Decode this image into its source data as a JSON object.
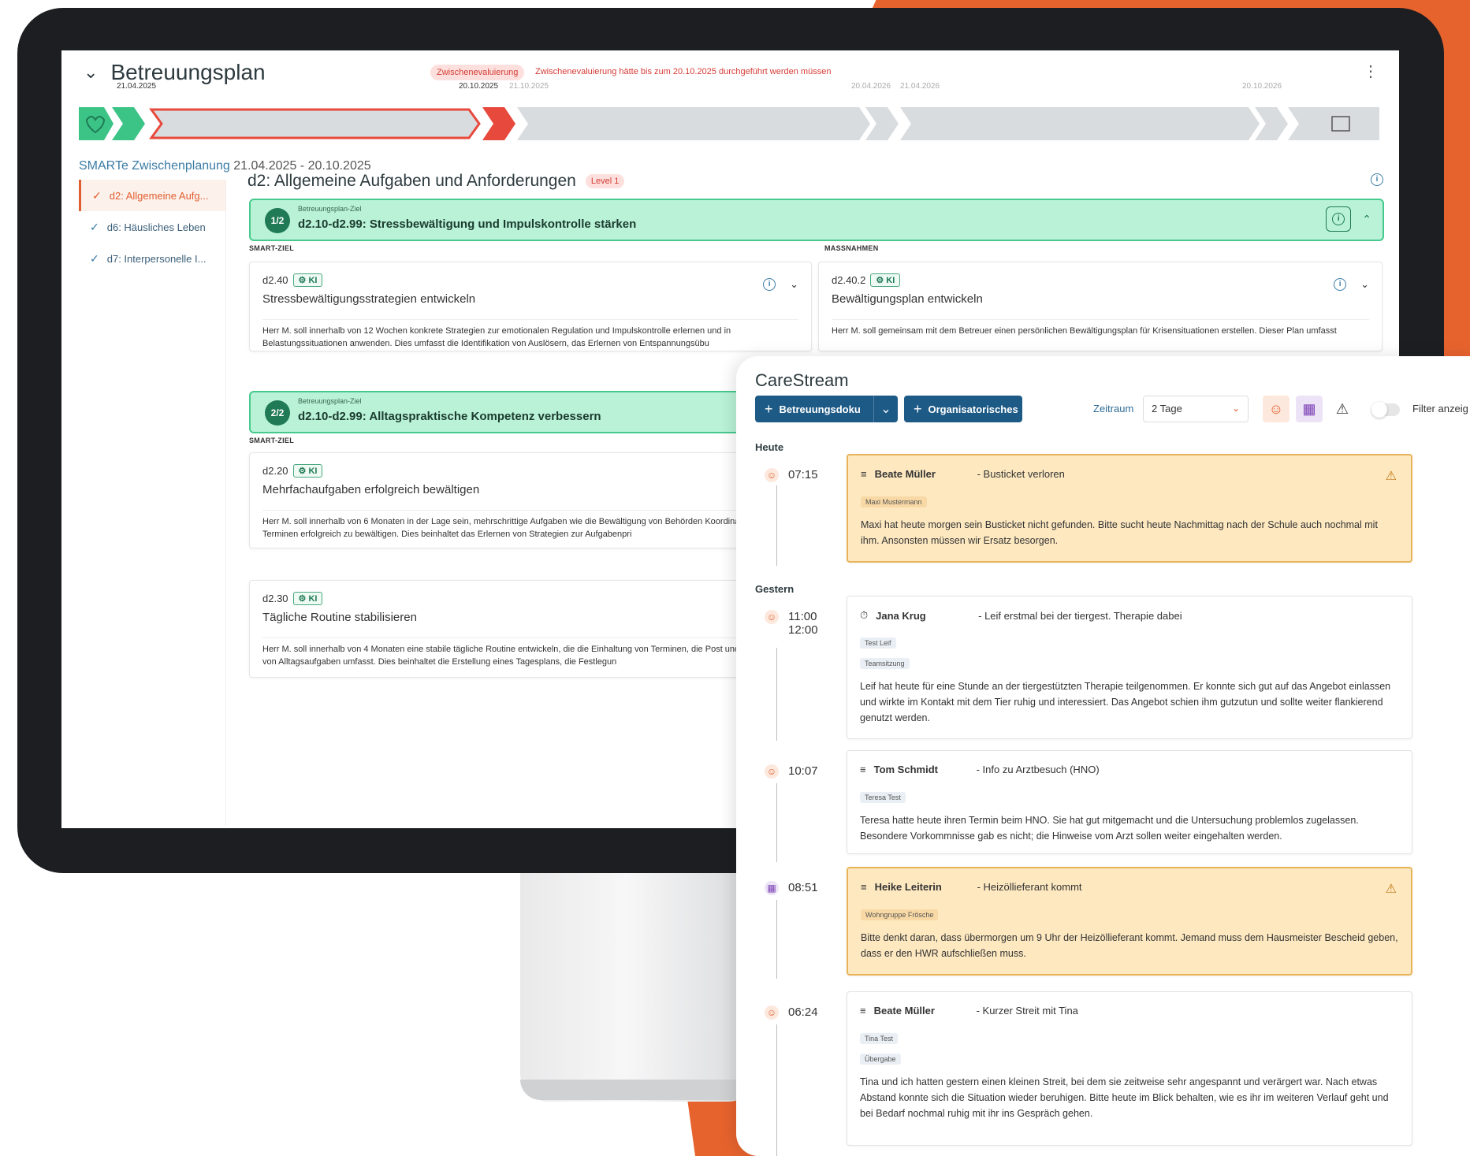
{
  "betreuungsplan": {
    "title": "Betreuungsplan",
    "eval_badge": "Zwischenevaluierung",
    "eval_warning": "Zwischenevaluierung hätte bis zum 20.10.2025 durchgeführt werden müssen",
    "timeline_dates": [
      "21.04.2025",
      "20.10.2025",
      "21.10.2025",
      "20.04.2026",
      "21.04.2026",
      "20.10.2026"
    ],
    "smarte_label": "SMARTe Zwischenplanung",
    "smarte_dates": "21.04.2025 - 20.10.2025",
    "sidebar": [
      {
        "label": "d2: Allgemeine Aufg...",
        "active": true
      },
      {
        "label": "d6: Häusliches Leben",
        "active": false
      },
      {
        "label": "d7: Interpersonelle I...",
        "active": false
      }
    ],
    "section_title": "d2: Allgemeine Aufgaben und Anforderungen",
    "level_badge": "Level 1",
    "goals": [
      {
        "num": "1/2",
        "kicker": "Betreuungsplan-Ziel",
        "label": "d2.10-d2.99: Stressbewältigung und Impulskontrolle stärken"
      },
      {
        "num": "2/2",
        "kicker": "Betreuungsplan-Ziel",
        "label": "d2.10-d2.99: Alltagspraktische Kompetenz verbessern"
      }
    ],
    "smart_ziel_label": "SMART-ZIEL",
    "massnahmen_label": "MASSNAHMEN",
    "ki_label": "KI",
    "cards": [
      {
        "code": "d2.40",
        "title": "Stressbewältigungsstrategien entwickeln",
        "desc": "Herr M. soll innerhalb von 12 Wochen konkrete Strategien zur emotionalen Regulation und Impulskontrolle erlernen und in Belastungssituationen anwenden. Dies umfasst die Identifikation von Auslösern, das Erlernen von Entspannungsübu"
      },
      {
        "code": "d2.40.2",
        "title": "Bewältigungsplan entwickeln",
        "desc": "Herr M. soll gemeinsam mit dem Betreuer einen persönlichen Bewältigungsplan für Krisensituationen erstellen. Dieser Plan umfasst"
      },
      {
        "code": "d2.20",
        "title": "Mehrfachaufgaben erfolgreich bewältigen",
        "desc": "Herr M. soll innerhalb von 6 Monaten in der Lage sein, mehrschrittige Aufgaben wie die Bewältigung von Behörden Koordination von Terminen erfolgreich zu bewältigen. Dies beinhaltet das Erlernen von Strategien zur Aufgabenpri"
      },
      {
        "code": "d2.30",
        "title": "Tägliche Routine stabilisieren",
        "desc": "Herr M. soll innerhalb von 4 Monaten eine stabile tägliche Routine entwickeln, die die Einhaltung von Terminen, die Post und die Erledigung von Alltagsaufgaben umfasst. Dies beinhaltet die Erstellung eines Tagesplans, die Festlegun"
      }
    ]
  },
  "carestream": {
    "title": "CareStream",
    "btn_betreuungsdoku": "Betreuungsdoku",
    "btn_organisatorisches": "Organisatorisches",
    "zeitraum_label": "Zeitraum",
    "zeitraum_value": "2 Tage",
    "filter_label": "Filter anzeig",
    "day_today": "Heute",
    "day_yesterday": "Gestern",
    "entries": [
      {
        "time": "07:15",
        "author": "Beate Müller",
        "subject": "- Busticket verloren",
        "tags": [
          "Maxi Mustermann"
        ],
        "body": "Maxi hat heute morgen sein Busticket nicht gefunden. Bitte sucht heute Nachmittag nach der Schule auch nochmal mit ihm. Ansonsten müssen wir Ersatz besorgen.",
        "warn": true
      },
      {
        "time": "11:00",
        "time_end": "12:00",
        "author": "Jana Krug",
        "subject": "- Leif erstmal bei der tiergest. Therapie dabei",
        "tags": [
          "Test Leif",
          "Teamsitzung"
        ],
        "body": "Leif hat heute für eine Stunde an der tiergestützten Therapie teilgenommen. Er konnte sich gut auf das Angebot einlassen und wirkte im Kontakt mit dem Tier ruhig und interessiert. Das Angebot schien ihm gutzutun und sollte weiter flankierend genutzt werden.",
        "warn": false
      },
      {
        "time": "10:07",
        "author": "Tom Schmidt",
        "subject": "- Info zu Arztbesuch (HNO)",
        "tags": [
          "Teresa Test"
        ],
        "body": "Teresa hatte heute ihren Termin beim HNO. Sie hat gut mitgemacht und die Untersuchung problemlos zugelassen. Besondere Vorkommnisse gab es nicht; die Hinweise vom Arzt sollen weiter eingehalten werden.",
        "warn": false
      },
      {
        "time": "08:51",
        "author": "Heike Leiterin",
        "subject": "- Heizöllieferant kommt",
        "tags": [
          "Wohngruppe Frösche"
        ],
        "body": "Bitte denkt daran, dass übermorgen um 9 Uhr der Heizöllieferant kommt. Jemand muss dem Hausmeister Bescheid geben, dass er den HWR aufschließen muss.",
        "warn": true
      },
      {
        "time": "06:24",
        "author": "Beate Müller",
        "subject": "- Kurzer Streit mit Tina",
        "tags": [
          "Tina Test",
          "Übergabe"
        ],
        "body": "Tina und ich hatten gestern einen kleinen Streit, bei dem sie zeitweise sehr angespannt und verärgert war. Nach etwas Abstand konnte sich die Situation wieder beruhigen. Bitte heute im Blick behalten, wie es ihr im weiteren Verlauf geht und bei Bedarf nochmal ruhig mit ihr ins Gespräch gehen.",
        "warn": false
      }
    ]
  },
  "colors": {
    "accent_orange": "#e7632e",
    "goal_green": "#b9f2d7",
    "primary_blue": "#1e5a86",
    "warn_bg": "#fde8c0"
  }
}
